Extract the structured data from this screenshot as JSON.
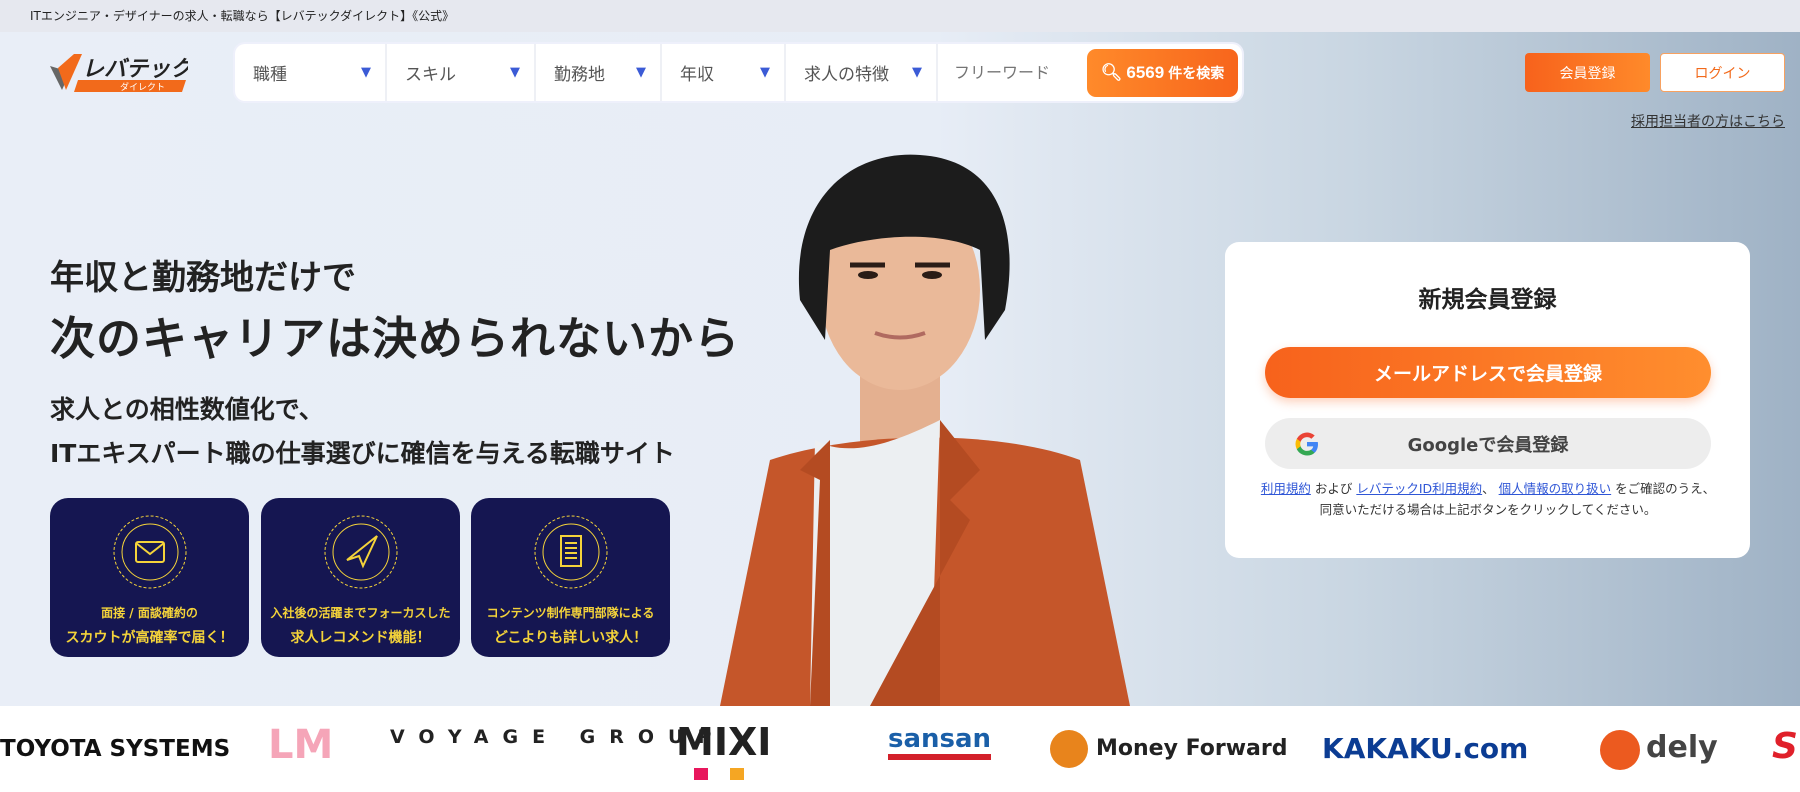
{
  "page_title": "ITエンジニア・デザイナーの求人・転職なら【レバテックダイレクト】《公式》",
  "logo": {
    "main": "レバテック",
    "sub": "ダイレクト"
  },
  "search": {
    "filters": [
      "職種",
      "スキル",
      "勤務地",
      "年収",
      "求人の特徴"
    ],
    "free_placeholder": "フリーワード",
    "count": "6569",
    "button_suffix": "件を検索"
  },
  "header": {
    "register": "会員登録",
    "login": "ログイン",
    "recruiter_link": "採用担当者の方はこちら"
  },
  "hero": {
    "line1": "年収と勤務地だけで",
    "line2": "次のキャリアは決められないから",
    "sub1": "求人との相性数値化で、",
    "sub2": "ITエキスパート職の仕事選びに確信を与える転職サイト"
  },
  "features": [
    {
      "icon": "envelope-icon",
      "l1": "面接 / 面談確約の",
      "l2": "スカウトが高確率で届く！"
    },
    {
      "icon": "paper-plane-icon",
      "l1": "入社後の活躍までフォーカスした",
      "l2": "求人レコメンド機能！"
    },
    {
      "icon": "document-icon",
      "l1": "コンテンツ制作専門部隊による",
      "l2": "どこよりも詳しい求人！"
    }
  ],
  "signup": {
    "title": "新規会員登録",
    "mail_button": "メールアドレスで会員登録",
    "google_button": "Googleで会員登録",
    "terms_link": "利用規約",
    "and": " および ",
    "id_terms_link": "レバテックID利用規約",
    "comma": "、 ",
    "privacy_link": "個人情報の取り扱い",
    "tail": " をご確認のうえ、同意いただける場合は上記ボタンをクリックしてください。"
  },
  "company_logos": [
    "TOYOTA SYSTEMS",
    "LM",
    "VOYAGE GROUP",
    "MIXI",
    "sansan",
    "Money Forward",
    "KAKAKU.com",
    "dely",
    "S"
  ],
  "colors": {
    "accent": "#f7651c",
    "navy": "#151651",
    "gold": "#f4d33a",
    "link": "#2f56d6"
  }
}
